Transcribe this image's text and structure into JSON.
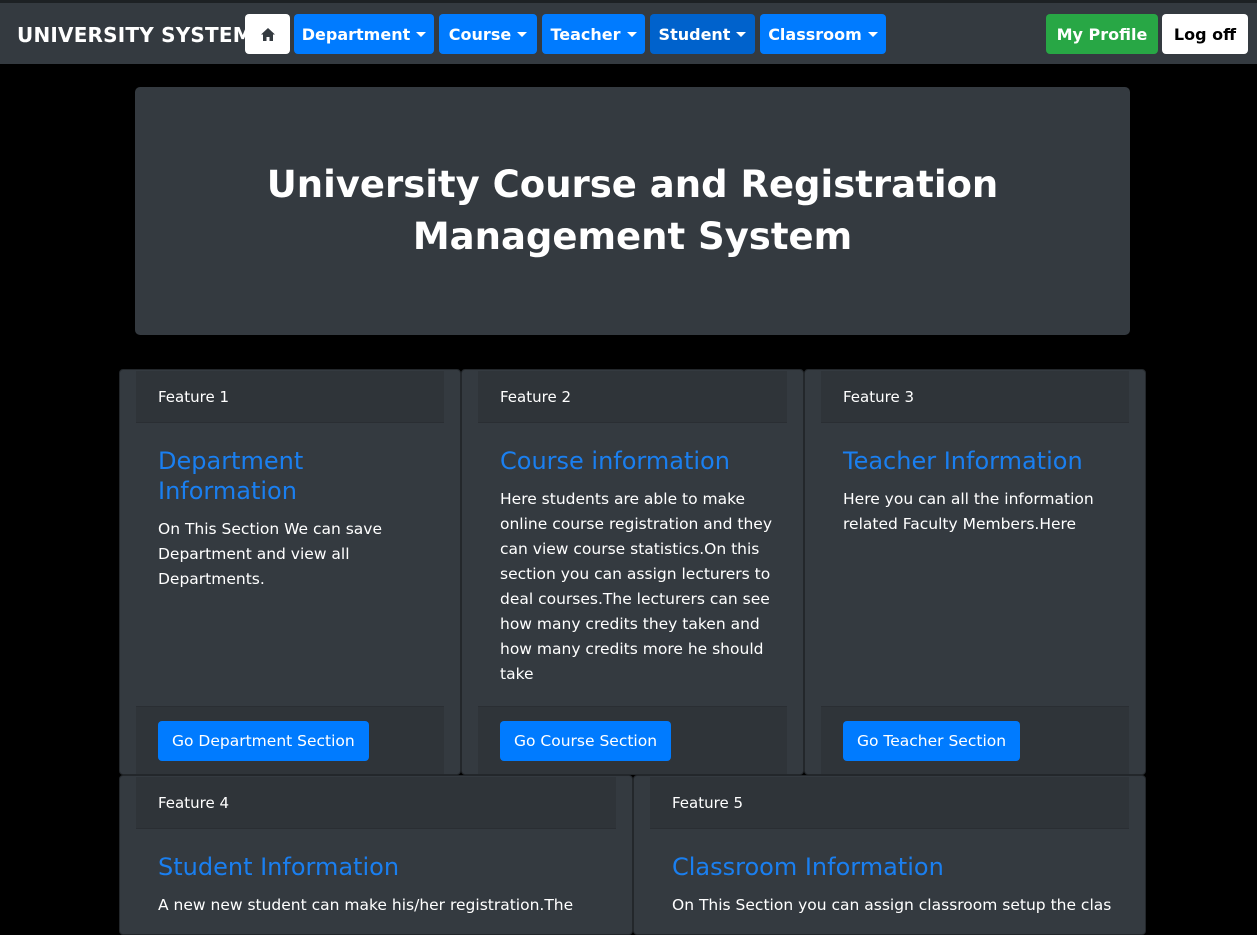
{
  "navbar": {
    "brand": "UNIVERSITY SYSTEM",
    "home_icon": "home-icon",
    "menus": [
      {
        "label": "Department"
      },
      {
        "label": "Course"
      },
      {
        "label": "Teacher"
      },
      {
        "label": "Student"
      },
      {
        "label": "Classroom"
      }
    ],
    "profile_label": "My Profile",
    "logoff_label": "Log off"
  },
  "hero": {
    "title": "University Course and Registration Management System"
  },
  "features": [
    {
      "header": "Feature 1",
      "title": "Department Information",
      "text": "On This Section We can save Department and view all Departments.",
      "button": "Go Department Section"
    },
    {
      "header": "Feature 2",
      "title": "Course information",
      "text": "Here students are able to make online course registration and they can view course statistics.On this section you can assign lecturers to deal courses.The lecturers can see how many credits they taken and how many credits more he should take",
      "button": "Go Course Section"
    },
    {
      "header": "Feature 3",
      "title": "Teacher Information",
      "text": "Here you can all the information related Faculty Members.Here",
      "button": "Go Teacher Section"
    },
    {
      "header": "Feature 4",
      "title": "Student Information",
      "text": "A new new student can make his/her registration.The"
    },
    {
      "header": "Feature 5",
      "title": "Classroom Information",
      "text": "On This Section you can assign classroom setup the class"
    }
  ],
  "colors": {
    "navbar_bg": "#343a40",
    "primary": "#007bff",
    "success": "#28a745",
    "card_bg": "#343a40",
    "title_link": "#1a7ff0"
  }
}
